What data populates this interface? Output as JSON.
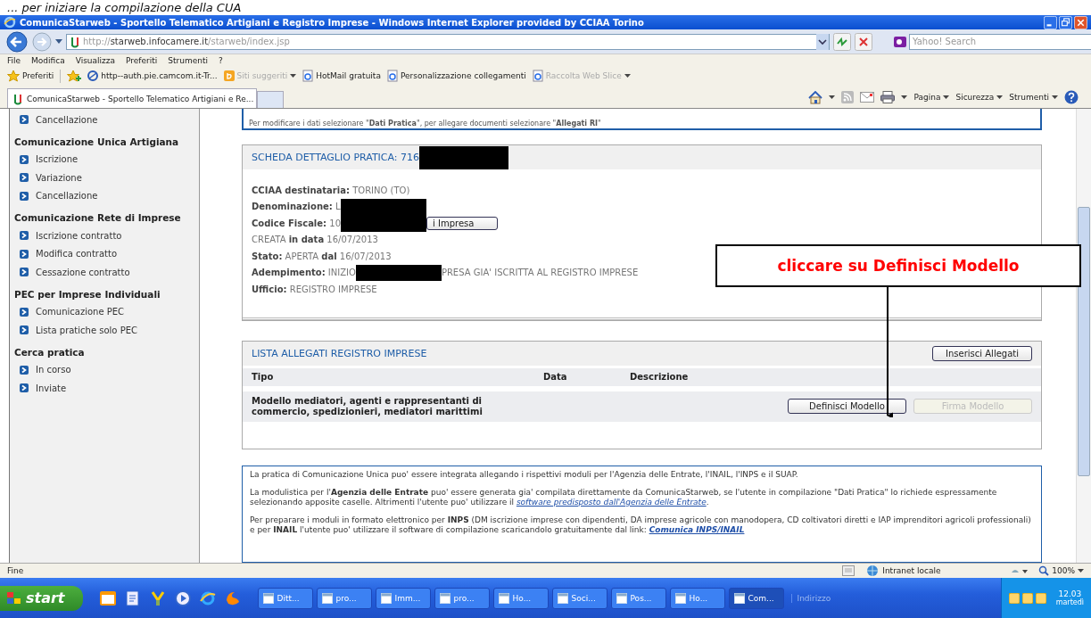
{
  "caption": "... per iniziare la compilazione della CUA",
  "window": {
    "title": "ComunicaStarweb - Sportello Telematico Artigiani e Registro Imprese - Windows Internet Explorer provided by CCIAA Torino"
  },
  "address": {
    "scheme": "http://",
    "host": "starweb.infocamere.it",
    "path": "/starweb/index.jsp"
  },
  "search": {
    "placeholder": "Yahoo! Search"
  },
  "menu": [
    "File",
    "Modifica",
    "Visualizza",
    "Preferiti",
    "Strumenti",
    "?"
  ],
  "favorites": {
    "label": "Preferiti",
    "links": [
      {
        "label": "http--auth.pie.camcom.it-Tr...",
        "disabled": false,
        "dropdown": false
      },
      {
        "label": "Siti suggeriti",
        "disabled": true,
        "dropdown": true
      },
      {
        "label": "HotMail gratuita",
        "disabled": false,
        "dropdown": false
      },
      {
        "label": "Personalizzazione collegamenti",
        "disabled": false,
        "dropdown": false
      },
      {
        "label": "Raccolta Web Slice",
        "disabled": true,
        "dropdown": true
      }
    ]
  },
  "tabs": [
    {
      "label": "ComunicaStarweb - Sportello Telematico Artigiani e Re...",
      "selected": true
    }
  ],
  "command_bar": [
    "Pagina",
    "Sicurezza",
    "Strumenti"
  ],
  "sidebar": {
    "entries": [
      {
        "kind": "link",
        "label": "Cancellazione"
      },
      {
        "kind": "heading",
        "label": "Comunicazione Unica Artigiana"
      },
      {
        "kind": "link",
        "label": "Iscrizione"
      },
      {
        "kind": "link",
        "label": "Variazione"
      },
      {
        "kind": "link",
        "label": "Cancellazione"
      },
      {
        "kind": "heading",
        "label": "Comunicazione Rete di Imprese"
      },
      {
        "kind": "link",
        "label": "Iscrizione contratto"
      },
      {
        "kind": "link",
        "label": "Modifica contratto"
      },
      {
        "kind": "link",
        "label": "Cessazione contratto"
      },
      {
        "kind": "heading",
        "label": "PEC per Imprese Individuali"
      },
      {
        "kind": "link",
        "label": "Comunicazione PEC"
      },
      {
        "kind": "link",
        "label": "Lista pratiche solo PEC"
      },
      {
        "kind": "heading",
        "label": "Cerca pratica"
      },
      {
        "kind": "link",
        "label": "In corso"
      },
      {
        "kind": "link",
        "label": "Inviate"
      }
    ]
  },
  "notice": "Per modificare i dati selezionare \"**Dati Pratica**\", per allegare documenti selezionare \"**Allegati RI**\"",
  "detail": {
    "title": "SCHEDA DETTAGLIO PRATICA: 716",
    "rows": [
      {
        "parts": [
          {
            "kind": "text",
            "text": "**CCIAA destinataria:** TORINO (TO)"
          }
        ]
      },
      {
        "parts": [
          {
            "kind": "text",
            "text": "**Denominazione:** L"
          },
          {
            "kind": "redaction"
          }
        ]
      },
      {
        "parts": [
          {
            "kind": "text",
            "text": "**Codice Fiscale:** 10"
          },
          {
            "kind": "redaction"
          },
          {
            "kind": "button",
            "text": "i Impresa"
          }
        ]
      },
      {
        "parts": [
          {
            "kind": "text",
            "text": "CREATA **in data** 16/07/2013"
          }
        ]
      },
      {
        "parts": [
          {
            "kind": "text",
            "text": "**Stato:** APERTA **dal** 16/07/2013"
          }
        ]
      },
      {
        "parts": [
          {
            "kind": "text",
            "text": "**Adempimento:** INIZIO"
          },
          {
            "kind": "redaction"
          },
          {
            "kind": "text",
            "text": "PRESA GIA' ISCRITTA AL REGISTRO IMPRESE"
          }
        ]
      },
      {
        "parts": [
          {
            "kind": "text",
            "text": "**Ufficio:** REGISTRO IMPRESE"
          }
        ]
      }
    ]
  },
  "attachments": {
    "title": "LISTA ALLEGATI REGISTRO IMPRESE",
    "add_button": "Inserisci Allegati",
    "columns": [
      "Tipo",
      "Data",
      "Descrizione"
    ],
    "rows": [
      {
        "tipo": "Modello mediatori, agenti e rappresentanti di commercio, spedizionieri, mediatori marittimi",
        "actions": [
          {
            "label": "Definisci Modello",
            "disabled": false
          },
          {
            "label": "Firma Modello",
            "disabled": true
          }
        ]
      }
    ]
  },
  "info": [
    [
      {
        "kind": "text",
        "text": "La pratica di Comunicazione Unica puo' essere integrata allegando i rispettivi moduli per l'Agenzia delle Entrate, l'INAIL, l'INPS e il SUAP."
      }
    ],
    [
      {
        "kind": "text",
        "text": "La modulistica per l'**Agenzia delle Entrate** puo' essere generata gia' compilata direttamente da ComunicaStarweb, se l'utente in compilazione \"Dati Pratica\" lo richiede espressamente selezionando apposite caselle. Altrimenti l'utente puo' utilizzare il "
      },
      {
        "kind": "link",
        "text": "software predisposto dall'Agenzia delle Entrate",
        "bold": false
      },
      {
        "kind": "text",
        "text": "."
      }
    ],
    [
      {
        "kind": "text",
        "text": "Per preparare i moduli in formato elettronico per **INPS** (DM iscrizione imprese con dipendenti, DA imprese agricole con manodopera, CD coltivatori diretti e IAP imprenditori agricoli professionali) e per **INAIL** l'utente puo' utilizzare il software di compilazione scaricandolo gratuitamente dal link: "
      },
      {
        "kind": "link",
        "text": "Comunica INPS/INAIL",
        "bold": true
      }
    ]
  ],
  "callout": "cliccare su Definisci Modello",
  "status_bar": {
    "text": "Fine",
    "zone": "Intranet locale",
    "zoom": "100%"
  },
  "taskbar": {
    "start": "start",
    "tasks": [
      {
        "label": "Ditt...",
        "selected": false
      },
      {
        "label": "pro...",
        "selected": false
      },
      {
        "label": "Imm...",
        "selected": false
      },
      {
        "label": "pro...",
        "selected": false
      },
      {
        "label": "Ho...",
        "selected": false
      },
      {
        "label": "Soci...",
        "selected": false
      },
      {
        "label": "Pos...",
        "selected": false
      },
      {
        "label": "Ho...",
        "selected": false
      },
      {
        "label": "Com...",
        "selected": true
      }
    ],
    "address_label": "Indirizzo",
    "time": "12.03",
    "day": "martedì"
  }
}
